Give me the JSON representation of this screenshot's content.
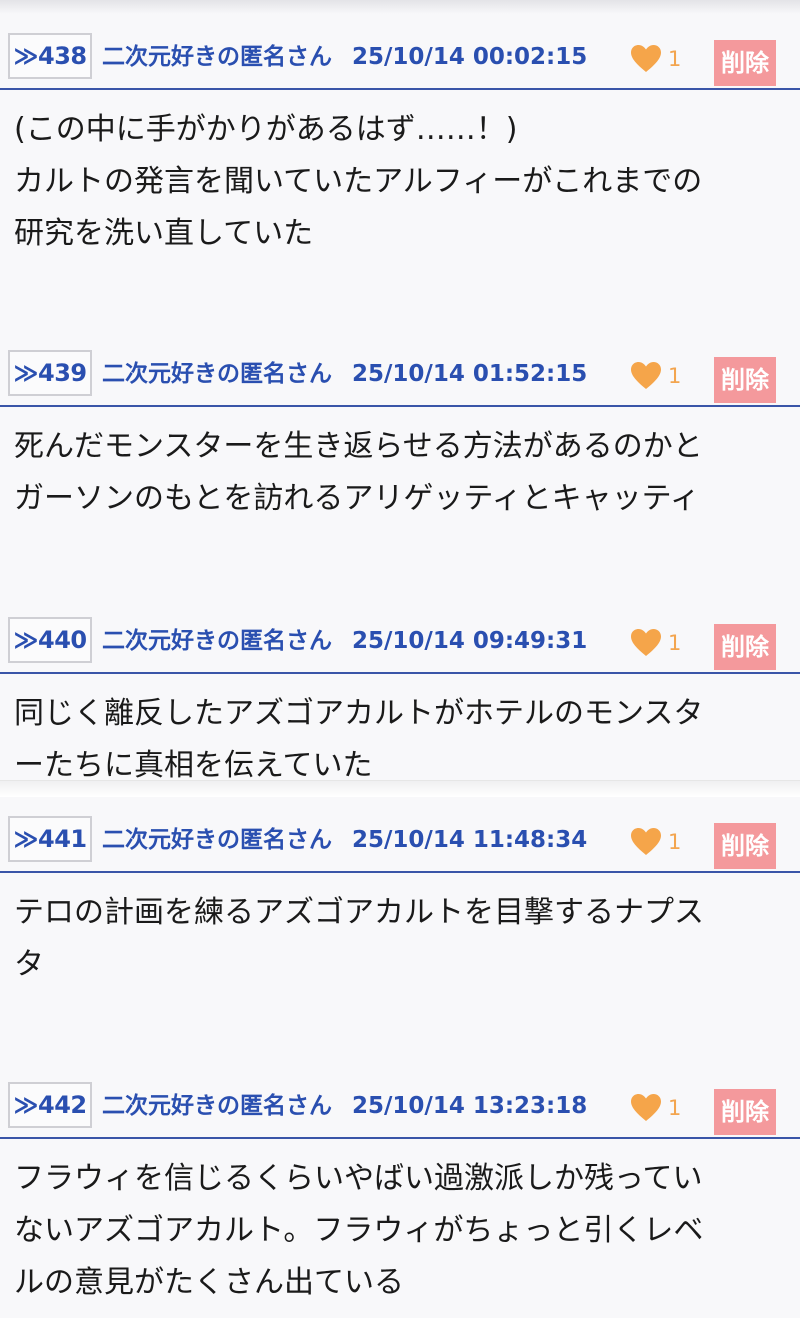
{
  "posts": [
    {
      "number": "≫438",
      "author": "二次元好きの匿名さん",
      "date": "25/10/14 00:02:15",
      "likes": "1",
      "delete_label": "削除",
      "text": "(この中に手がかりがあるはず……！)\nカルトの発言を聞いていたアルフィーがこれまでの\n研究を洗い直していた"
    },
    {
      "number": "≫439",
      "author": "二次元好きの匿名さん",
      "date": "25/10/14 01:52:15",
      "likes": "1",
      "delete_label": "削除",
      "text": "死んだモンスターを生き返らせる方法があるのかと\nガーソンのもとを訪れるアリゲッティとキャッティ"
    },
    {
      "number": "≫440",
      "author": "二次元好きの匿名さん",
      "date": "25/10/14 09:49:31",
      "likes": "1",
      "delete_label": "削除",
      "text": "同じく離反したアズゴアカルトがホテルのモンスタ\nーたちに真相を伝えていた"
    },
    {
      "number": "≫441",
      "author": "二次元好きの匿名さん",
      "date": "25/10/14 11:48:34",
      "likes": "1",
      "delete_label": "削除",
      "text": "テロの計画を練るアズゴアカルトを目撃するナプス\nタ"
    },
    {
      "number": "≫442",
      "author": "二次元好きの匿名さん",
      "date": "25/10/14 13:23:18",
      "likes": "1",
      "delete_label": "削除",
      "text": "フラウィを信じるくらいやばい過激派しか残ってい\nないアズゴアカルト。フラウィがちょっと引くレベ\nルの意見がたくさん出ている"
    }
  ],
  "colors": {
    "link_blue": "#2a4fb0",
    "delete_bg": "#f4999c",
    "heart": "#f5a54a",
    "divider": "#3a55a8"
  },
  "icons": {
    "like": "heart-icon"
  }
}
